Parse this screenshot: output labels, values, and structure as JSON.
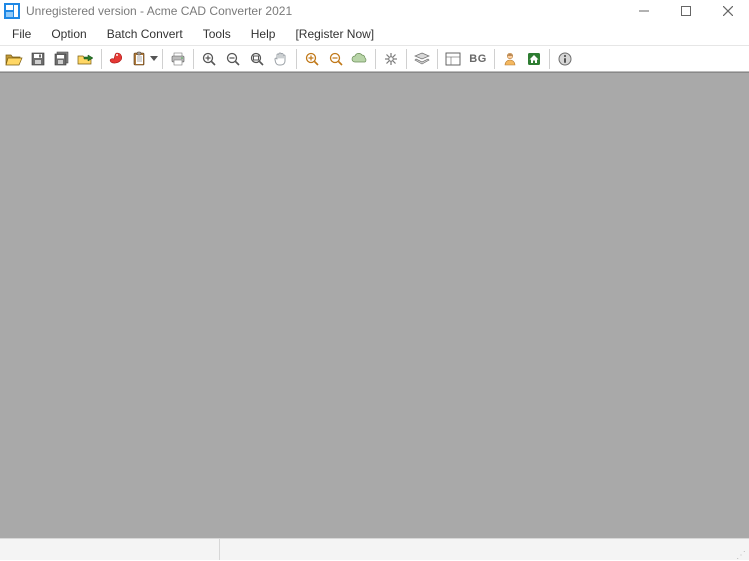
{
  "title": "Unregistered version - Acme CAD Converter 2021",
  "menus": [
    "File",
    "Option",
    "Batch Convert",
    "Tools",
    "Help",
    "[Register Now]"
  ],
  "toolbar": {
    "bg_label": "BG"
  }
}
